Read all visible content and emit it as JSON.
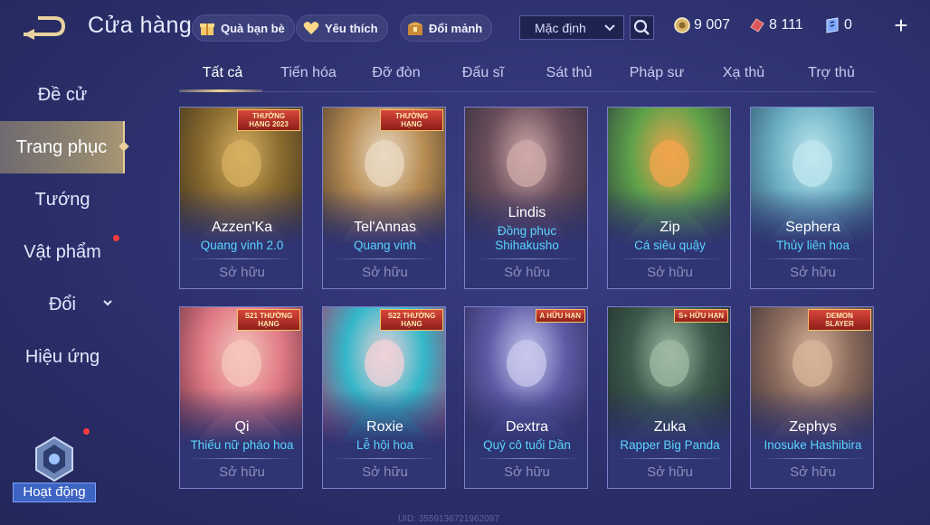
{
  "header": {
    "title": "Cửa hàng",
    "chips": [
      {
        "label": "Quà bạn bè",
        "icon": "gift-icon"
      },
      {
        "label": "Yêu thích",
        "icon": "heart-icon"
      },
      {
        "label": "Đổi mảnh",
        "icon": "chest-icon"
      }
    ],
    "sort": {
      "selected": "Mặc định"
    },
    "currencies": [
      {
        "icon": "gold-coin-icon",
        "value": "9 007"
      },
      {
        "icon": "red-voucher-icon",
        "value": "8 111"
      },
      {
        "icon": "ticket-icon",
        "value": "0"
      }
    ],
    "plus_label": "+"
  },
  "sidebar": {
    "items": [
      {
        "label": "Đề cử"
      },
      {
        "label": "Trang phục"
      },
      {
        "label": "Tướng"
      },
      {
        "label": "Vật phẩm"
      },
      {
        "label": "Đổi"
      },
      {
        "label": "Hiệu ứng"
      }
    ],
    "active_index": 1,
    "event_label": "Hoạt động"
  },
  "tabs": {
    "items": [
      {
        "label": "Tất cả"
      },
      {
        "label": "Tiến hóa"
      },
      {
        "label": "Đỡ đòn"
      },
      {
        "label": "Đấu sĩ"
      },
      {
        "label": "Sát thủ"
      },
      {
        "label": "Pháp sư"
      },
      {
        "label": "Xạ thủ"
      },
      {
        "label": "Trợ thủ"
      }
    ],
    "active_index": 0
  },
  "cards": [
    {
      "hero": "Azzen'Ka",
      "skin": "Quang vinh 2.0",
      "status": "Sở hữu",
      "badge": "THƯỜNG HẠNG 2023",
      "art": [
        "#d7b061",
        "#8a6b2f",
        "#3a2f1c"
      ]
    },
    {
      "hero": "Tel'Annas",
      "skin": "Quang vinh",
      "status": "Sở hữu",
      "badge": "THƯỜNG HẠNG",
      "art": [
        "#e9d9c2",
        "#b78c54",
        "#4b3a2a"
      ]
    },
    {
      "hero": "Lindis",
      "skin": "Đồng phục Shihakusho",
      "status": "Sở hữu",
      "badge": "",
      "art": [
        "#cfa9a8",
        "#6b4f5c",
        "#2e2a3c"
      ]
    },
    {
      "hero": "Zip",
      "skin": "Cá siêu quậy",
      "status": "Sở hữu",
      "badge": "",
      "art": [
        "#f2a54c",
        "#5da24a",
        "#2b3a3e"
      ]
    },
    {
      "hero": "Sephera",
      "skin": "Thủy liên hoa",
      "status": "Sở hữu",
      "badge": "",
      "art": [
        "#bfe7ef",
        "#6cb0c4",
        "#2f4e6a"
      ]
    },
    {
      "hero": "Qi",
      "skin": "Thiếu nữ pháo hoa",
      "status": "Sở hữu",
      "badge": "S21 THƯỜNG HẠNG",
      "art": [
        "#f5c7bf",
        "#e07b86",
        "#6b2f3e"
      ]
    },
    {
      "hero": "Roxie",
      "skin": "Lễ hội hoa",
      "status": "Sở hữu",
      "badge": "S22 THƯỜNG HẠNG",
      "art": [
        "#f1d2d8",
        "#34b7c9",
        "#a83a6a"
      ]
    },
    {
      "hero": "Dextra",
      "skin": "Quý cô tuổi Dần",
      "status": "Sở hữu",
      "badge": "A HỮU HẠN",
      "art": [
        "#c8c8ee",
        "#5d5aa6",
        "#2b2853"
      ]
    },
    {
      "hero": "Zuka",
      "skin": "Rapper Big Panda",
      "status": "Sở hữu",
      "badge": "S+ HỮU HẠN",
      "art": [
        "#9fb9a3",
        "#3d5a4c",
        "#1d2a2a"
      ]
    },
    {
      "hero": "Zephys",
      "skin": "Inosuke Hashibira",
      "status": "Sở hữu",
      "badge": "DEMON SLAYER",
      "art": [
        "#d8b49a",
        "#8a6a5c",
        "#3a3036"
      ]
    }
  ],
  "footer": {
    "uid": "UID: 3559136721962097"
  },
  "colors": {
    "accent_gold": "#f0d28f",
    "skin_name": "#5ad4ff",
    "notification": "#ff3b3b"
  }
}
